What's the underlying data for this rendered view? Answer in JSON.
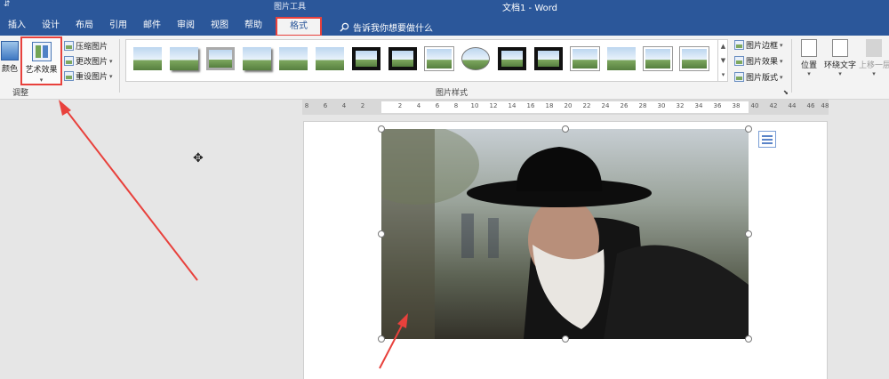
{
  "window": {
    "title": "文档1  -  Word",
    "context_tab_group": "图片工具",
    "qa_menu": "⇵"
  },
  "tabs": [
    {
      "label": "插入"
    },
    {
      "label": "设计"
    },
    {
      "label": "布局"
    },
    {
      "label": "引用"
    },
    {
      "label": "邮件"
    },
    {
      "label": "审阅"
    },
    {
      "label": "视图"
    },
    {
      "label": "帮助"
    },
    {
      "label": "格式",
      "active": true
    }
  ],
  "tell_me": {
    "text": "告诉我你想要做什么"
  },
  "ribbon": {
    "adjust": {
      "color_label": "颜色",
      "art_effects_label": "艺术效果",
      "compress_label": "压缩图片",
      "change_label": "更改图片",
      "reset_label": "重设图片",
      "group_label": "调整"
    },
    "picture_styles": {
      "group_label": "图片样式",
      "border_label": "图片边框",
      "effects_label": "图片效果",
      "layout_label": "图片版式"
    },
    "arrange": {
      "position_label": "位置",
      "wrap_label": "环绕文字",
      "bring_forward_label": "上移一层"
    }
  },
  "ruler": {
    "ticks": [
      "8",
      "6",
      "4",
      "2",
      "",
      "2",
      "4",
      "6",
      "8",
      "10",
      "12",
      "14",
      "16",
      "18",
      "20",
      "22",
      "24",
      "26",
      "28",
      "30",
      "32",
      "34",
      "36",
      "38",
      "40",
      "42",
      "44",
      "46",
      "48"
    ]
  },
  "colors": {
    "titlebar": "#2b579a",
    "highlight": "#e8413c",
    "ribbon": "#f3f3f3"
  }
}
